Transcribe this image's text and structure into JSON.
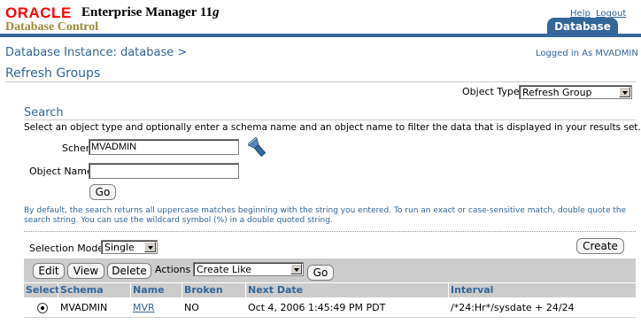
{
  "header": {
    "brand": "ORACLE",
    "product": "Enterprise Manager",
    "version": "11",
    "version_suffix": "g",
    "subtitle": "Database Control",
    "help_link": "Help",
    "logout_link": "Logout",
    "tab": "Database",
    "accent_color": "#336699"
  },
  "breadcrumb": "Database Instance: database  >",
  "logged_in": "Logged in As MVADMIN",
  "page_title": "Refresh Groups",
  "object_type": {
    "label": "Object Type",
    "value": "Refresh Group"
  },
  "search": {
    "header": "Search",
    "description": "Select an object type and optionally enter a schema name and an object name to filter the data that is displayed in your results set.",
    "schema_label": "Schema",
    "schema_value": "MVADMIN",
    "object_name_label": "Object Name",
    "object_name_value": "",
    "go_label": "Go",
    "flashlight_icon": "flashlight-icon",
    "hint": "By default, the search returns all uppercase matches beginning with the string you entered. To run an exact or case-sensitive match, double quote the search string. You can use the wildcard symbol (%) in a double quoted string."
  },
  "results": {
    "selection_mode_label": "Selection Mode",
    "selection_mode_value": "Single",
    "create_label": "Create",
    "edit_label": "Edit",
    "view_label": "View",
    "delete_label": "Delete",
    "actions_label": "Actions",
    "actions_value": "Create Like",
    "go_label": "Go",
    "columns": [
      "Select",
      "Schema",
      "Name",
      "Broken",
      "Next Date",
      "Interval"
    ],
    "rows": [
      {
        "selected": true,
        "schema": "MVADMIN",
        "name": "MVR",
        "broken": "NO",
        "next_date": "Oct 4, 2006 1:45:49 PM PDT",
        "interval": "/*24:Hr*/sysdate + 24/24"
      }
    ]
  }
}
